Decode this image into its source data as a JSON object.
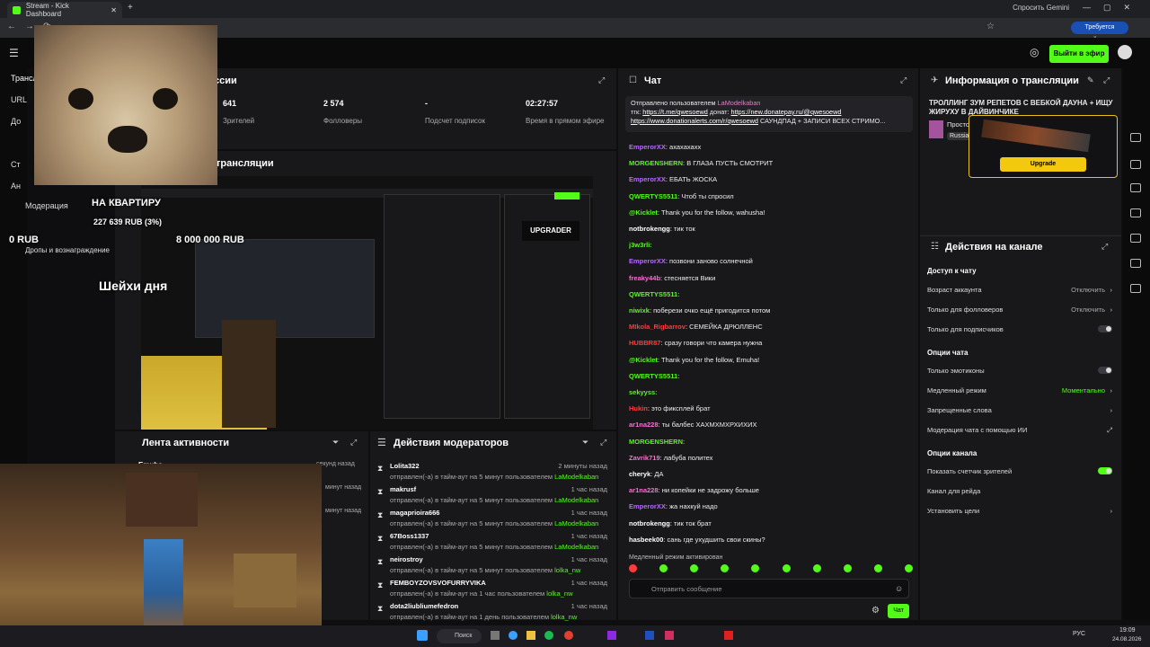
{
  "browser": {
    "tab_title": "Stream - Kick Dashboard",
    "gemini": "Спросить Gemini",
    "action_required": "Требуется действие"
  },
  "topnav": {
    "go_live": "Выйти в эфир"
  },
  "sidebar": {
    "items": [
      {
        "label": "Трансляция"
      },
      {
        "label": "URL"
      },
      {
        "label": "До"
      },
      {
        "label": "Ст"
      },
      {
        "label": "Ан"
      },
      {
        "label": "Модерация"
      },
      {
        "label": "Дропы и вознаграждение"
      }
    ]
  },
  "session": {
    "title_suffix": "ссии",
    "stats": [
      {
        "value": "641",
        "label": "Зрителей"
      },
      {
        "value": "2 574",
        "label": "Фолловеры"
      },
      {
        "value": "-",
        "label": "Подсчет подписок"
      },
      {
        "value": "02:27:57",
        "label": "Время в прямом эфире"
      }
    ],
    "preview_title": "трансляции"
  },
  "overlay": {
    "goal_label": "НА КВАРТИРУ",
    "goal_progress": "227 639 RUB (3%)",
    "goal_start": "0 RUB",
    "goal_end": "8 000 000 RUB",
    "sheikh": "Шейхи дня",
    "upgrader": "UPGRADER"
  },
  "activity": {
    "title": "Лента активности",
    "rows": [
      {
        "name": "Emuha",
        "time": "секунд назад"
      },
      {
        "name": "",
        "time": "минут назад"
      },
      {
        "name": "",
        "time": "минут назад"
      },
      {
        "name": "",
        "time": "минут назад"
      },
      {
        "name": "",
        "time": "минут назад"
      },
      {
        "name": "",
        "time": "минут назад"
      },
      {
        "name": "",
        "time": "минут назад"
      }
    ]
  },
  "moderators": {
    "title": "Действия модераторов",
    "rows": [
      {
        "name": "Lolita322",
        "time": "2 минуты назад",
        "desc": "отправлен(-а) в тайм-аут на 5 минут пользователем ",
        "by": "LaModelkaban"
      },
      {
        "name": "makrusf",
        "time": "1 час назад",
        "desc": "отправлен(-а) в тайм-аут на 5 минут пользователем ",
        "by": "LaModelkaban"
      },
      {
        "name": "magaprioira666",
        "time": "1 час назад",
        "desc": "отправлен(-а) в тайм-аут на 5 минут пользователем ",
        "by": "LaModelkaban"
      },
      {
        "name": "67Boss1337",
        "time": "1 час назад",
        "desc": "отправлен(-а) в тайм-аут на 5 минут пользователем ",
        "by": "LaModelkaban"
      },
      {
        "name": "neirostroy",
        "time": "1 час назад",
        "desc": "отправлен(-а) в тайм-аут на 5 минут пользователем ",
        "by": "lolka_nw"
      },
      {
        "name": "FEMBOYZOVSVOFURRYVIKA",
        "time": "1 час назад",
        "desc": "отправлен(-а) в тайм-аут на 1 час пользователем ",
        "by": "lolka_nw"
      },
      {
        "name": "dota2liubliumefedron",
        "time": "1 час назад",
        "desc": "отправлен(-а) в тайм-аут на 1 день пользователем ",
        "by": "lolka_nw"
      }
    ]
  },
  "chat": {
    "title": "Чат",
    "pinned_by": "Отправлено пользователем",
    "pinned_user": "LaModelkaban",
    "pinned_l1a": "тгк: ",
    "pinned_l1b": "https://t.me/qwesoewd",
    "pinned_l1c": " донат: ",
    "pinned_l1d": "https://new.donatepay.ru/@qwesoewd",
    "pinned_l2a": "https://www.donationalerts.com/r/qwesoewd",
    "pinned_l2b": " САУНДПАД + ЗАПИСИ ВСЕХ СТРИМО...",
    "messages": [
      {
        "user": "EmperorXX",
        "color": "#b36bff",
        "text": "ахахахахх"
      },
      {
        "user": "MORGENSHERN",
        "color": "#53fc18",
        "text": "В ГЛАЗА ПУСТЬ СМОТРИТ"
      },
      {
        "user": "EmperorXX",
        "color": "#b36bff",
        "text": "ЕБАТЬ ЖОСКА"
      },
      {
        "user": "QWERTYS5511",
        "color": "#53fc18",
        "text": "Чтоб ты спросил"
      },
      {
        "user": "@Kicklet",
        "color": "#53fc18",
        "text": "Thank you for the follow, wahusha!"
      },
      {
        "user": "notbrokengg",
        "color": "#fff",
        "text": "тик ток"
      },
      {
        "user": "j3w3rli",
        "color": "#53fc18",
        "text": ""
      },
      {
        "user": "EmperorXX",
        "color": "#b36bff",
        "text": "позвони заново солнечной"
      },
      {
        "user": "freaky44b",
        "color": "#ff6bd5",
        "text": "стесняется Вики"
      },
      {
        "user": "QWERTYS5511",
        "color": "#53fc18",
        "text": ""
      },
      {
        "user": "niwixk",
        "color": "#53fc18",
        "text": "поберези очко ещё пригодится потом"
      },
      {
        "user": "MIkola_Rigbarrov",
        "color": "#ff3b3b",
        "text": "СЕМЕЙКА ДРЮЛЛЕНС"
      },
      {
        "user": "HUBBR87",
        "color": "#ff3b3b",
        "text": "сразу говори что камера нужна"
      },
      {
        "user": "@Kicklet",
        "color": "#53fc18",
        "text": "Thank you for the follow, Emuha!"
      },
      {
        "user": "QWERTYS5511",
        "color": "#53fc18",
        "text": ""
      },
      {
        "user": "sekyyss",
        "color": "#53fc18",
        "text": ""
      },
      {
        "user": "Hukin",
        "color": "#ff3b3b",
        "text": "это фиксплей брат"
      },
      {
        "user": "ar1na228",
        "color": "#ff6bd5",
        "text": "ты балбес ХАХМХМХРХИХИХ"
      },
      {
        "user": "MORGENSHERN",
        "color": "#53fc18",
        "text": ""
      },
      {
        "user": "Zavrik719",
        "color": "#ff6bd5",
        "text": "лабуба политех"
      },
      {
        "user": "cheryk",
        "color": "#fff",
        "text": "ДА"
      },
      {
        "user": "ar1na228",
        "color": "#ff6bd5",
        "text": "ни копейки не задрожу больше"
      },
      {
        "user": "EmperorXX",
        "color": "#b36bff",
        "text": "жа нахкуй надо"
      },
      {
        "user": "notbrokengg",
        "color": "#fff",
        "text": "тик ток брат"
      },
      {
        "user": "hasbeek00",
        "color": "#fff",
        "text": "сань где ухудшить свои скины?"
      }
    ],
    "slow_mode": "Медленный режим активирован",
    "input_placeholder": "Отправить сообщение",
    "send": "Чат"
  },
  "info": {
    "title": "Информация о трансляции",
    "stream_title": "ТРОЛЛИНГ ЗУМ РЕПЕТОВ С ВЕБКОЙ ДАУНА + ИЩУ ЖИРУХУ В ДАЙВИНЧИКЕ",
    "cat1": "Просто",
    "cat2": "Russia",
    "upgrade": "Upgrade"
  },
  "actions": {
    "title": "Действия на канале",
    "access_title": "Доступ к чату",
    "age": "Возраст аккаунта",
    "age_val": "Отключить",
    "followers": "Только для фолловеров",
    "followers_val": "Отключить",
    "subs": "Только для подписчиков",
    "chat_opts": "Опции чата",
    "emotes": "Только эмотиконы",
    "slow": "Медленный режим",
    "slow_val": "Моментально",
    "banned": "Запрещенные слова",
    "ai_mod": "Модерация чата с помощью ИИ",
    "channel_opts": "Опции канала",
    "viewer_count": "Показать счетчик зрителей",
    "raid": "Канал для рейда",
    "goals": "Установить цели"
  },
  "taskbar": {
    "search": "Поиск",
    "lang": "РУС",
    "time": "19:09",
    "date": "24.08.2026"
  },
  "colors": {
    "accent": "#53fc18",
    "panel": "#18181b",
    "bg": "#0e0e10"
  }
}
